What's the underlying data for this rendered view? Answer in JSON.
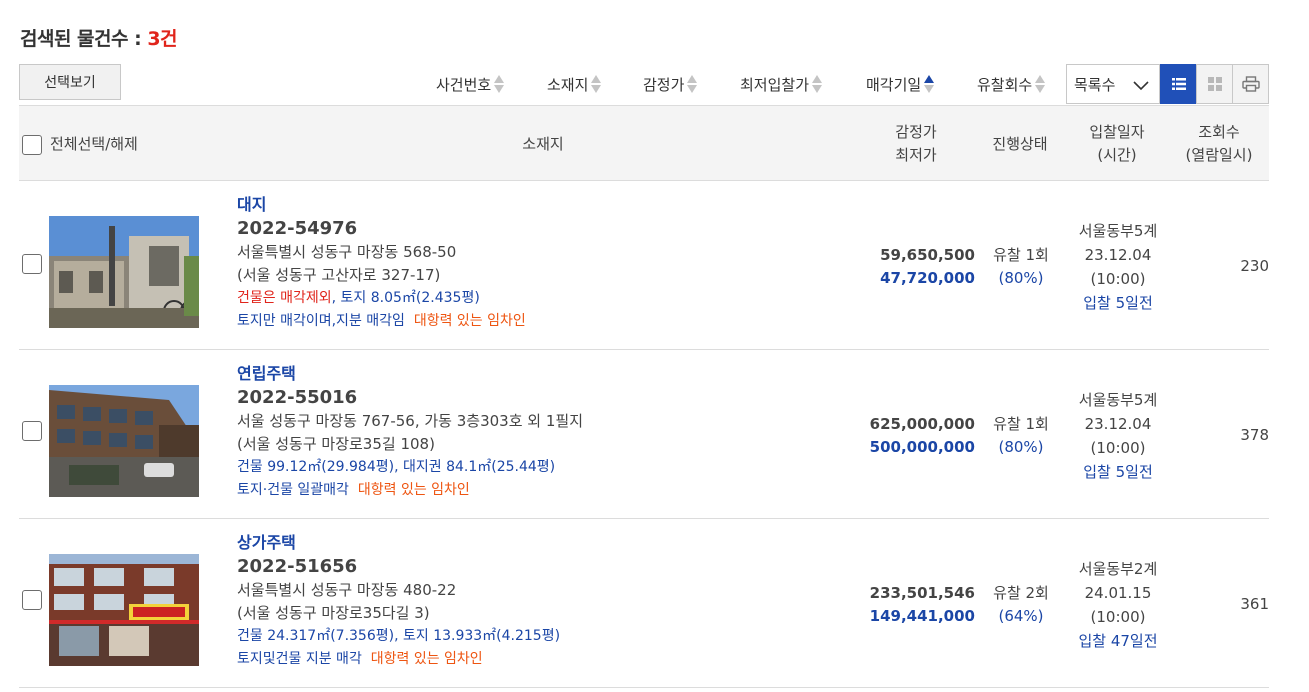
{
  "header": {
    "title_prefix": "검색된 물건수 : ",
    "count": "3건",
    "select_view": "선택보기"
  },
  "sort": {
    "items": [
      {
        "label": "사건번호",
        "active": false
      },
      {
        "label": "소재지",
        "active": false
      },
      {
        "label": "감정가",
        "active": false
      },
      {
        "label": "최저입찰가",
        "active": false
      },
      {
        "label": "매각기일",
        "active": true
      },
      {
        "label": "유찰회수",
        "active": false
      }
    ],
    "page_size_selected": "목록수"
  },
  "columns": {
    "select_all": "전체선택/해제",
    "location": "소재지",
    "appraisal": "감정가",
    "min_price": "최저가",
    "status": "진행상태",
    "bid_date": "입찰일자",
    "bid_time": "(시간)",
    "views": "조회수",
    "view_time": "(열람일시)"
  },
  "rows": [
    {
      "type": "대지",
      "case_no": "2022-54976",
      "address": "서울특별시 성동구 마장동 568-50",
      "road_address": "(서울 성동구 고산자로 327-17)",
      "detail_red": "건물은 매각제외",
      "detail_blue": ", 토지 8.05㎡(2.435평)",
      "note": "토지만 매각이며,지분 매각임",
      "tenant": "대항력 있는 임차인",
      "appraisal": "59,650,500",
      "min_price": "47,720,000",
      "status": "유찰 1회",
      "percent": "(80%)",
      "court": "서울동부5계",
      "date": "23.12.04",
      "time": "(10:00)",
      "due": "입찰 5일전",
      "views": "230"
    },
    {
      "type": "연립주택",
      "case_no": "2022-55016",
      "address": "서울 성동구 마장동 767-56, 가동 3층303호 외 1필지",
      "road_address": "(서울 성동구 마장로35길 108)",
      "detail_red": "",
      "detail_blue": "건물 99.12㎡(29.984평), 대지권 84.1㎡(25.44평)",
      "note": "토지·건물 일괄매각",
      "tenant": "대항력 있는 임차인",
      "appraisal": "625,000,000",
      "min_price": "500,000,000",
      "status": "유찰 1회",
      "percent": "(80%)",
      "court": "서울동부5계",
      "date": "23.12.04",
      "time": "(10:00)",
      "due": "입찰 5일전",
      "views": "378"
    },
    {
      "type": "상가주택",
      "case_no": "2022-51656",
      "address": "서울특별시 성동구 마장동 480-22",
      "road_address": "(서울 성동구 마장로35다길 3)",
      "detail_red": "",
      "detail_blue": "건물 24.317㎡(7.356평), 토지 13.933㎡(4.215평)",
      "note": "토지및건물 지분 매각",
      "tenant": "대항력 있는 임차인",
      "appraisal": "233,501,546",
      "min_price": "149,441,000",
      "status": "유찰 2회",
      "percent": "(64%)",
      "court": "서울동부2계",
      "date": "24.01.15",
      "time": "(10:00)",
      "due": "입찰 47일전",
      "views": "361"
    }
  ],
  "colors": {
    "accent": "#1b46a6",
    "red": "#e0241b",
    "orange": "#ee5511"
  }
}
